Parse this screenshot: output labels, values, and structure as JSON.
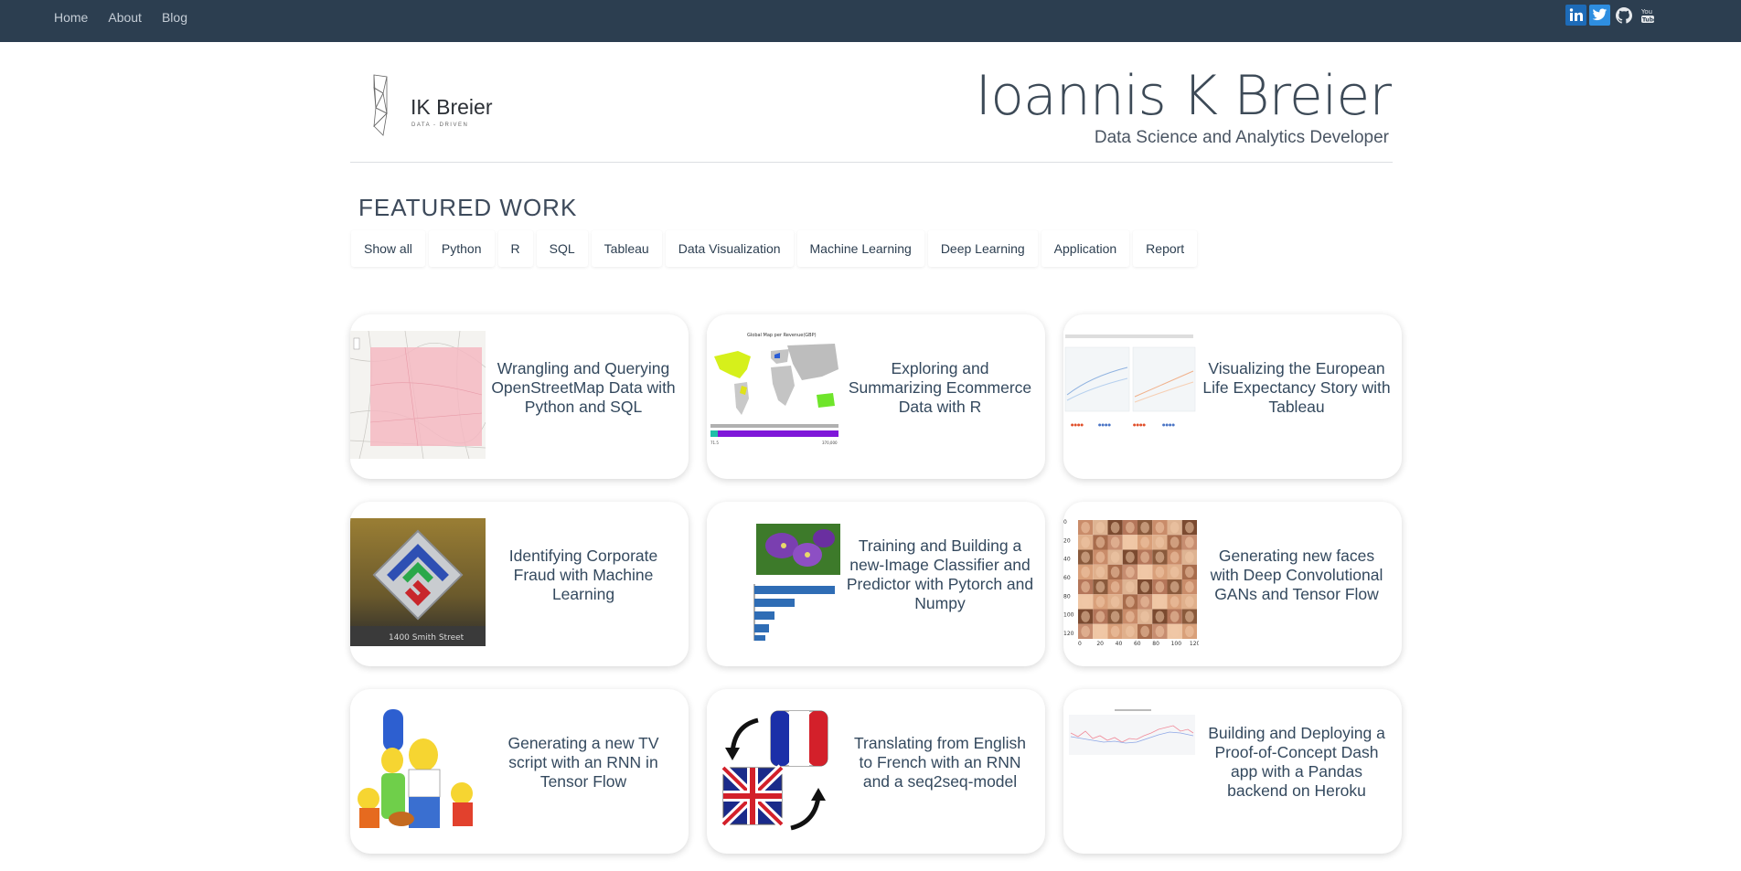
{
  "nav": {
    "links": [
      "Home",
      "About",
      "Blog"
    ],
    "social": [
      "linkedin-icon",
      "twitter-icon",
      "github-icon",
      "youtube-icon"
    ]
  },
  "header": {
    "logo_text": "IK Breier",
    "logo_sub": "DATA - DRIVEN",
    "title": "Ioannis K Breier",
    "subtitle": "Data Science and Analytics Developer"
  },
  "featured": {
    "heading": "FEATURED WORK",
    "filters": [
      "Show all",
      "Python",
      "R",
      "SQL",
      "Tableau",
      "Data Visualization",
      "Machine Learning",
      "Deep Learning",
      "Application",
      "Report"
    ]
  },
  "cards": [
    {
      "title": "Wrangling and Querying OpenStreetMap Data with Python and SQL",
      "thumb": "map-thumbnail"
    },
    {
      "title": "Exploring and Summarizing Ecommerce Data with R",
      "thumb": "world-map-thumbnail",
      "thumb_title": "Global Map per Revenue(GBP)"
    },
    {
      "title": "Visualizing the European Life Expectancy Story with Tableau",
      "thumb": "dashboard-thumbnail"
    },
    {
      "title": "Identifying Corporate Fraud with Machine Learning",
      "thumb": "enron-logo-thumbnail",
      "thumb_text": "1400 Smith Street"
    },
    {
      "title": "Training and Building a new-Image Classifier and Predictor with Pytorch and Numpy",
      "thumb": "flower-classifier-thumbnail"
    },
    {
      "title": "Generating new faces with Deep Convolutional GANs and Tensor Flow",
      "thumb": "faces-grid-thumbnail",
      "thumb_ticks_y": [
        "0",
        "20",
        "40",
        "60",
        "80",
        "100",
        "120"
      ],
      "thumb_ticks_x": [
        "0",
        "20",
        "40",
        "60",
        "80",
        "100",
        "120"
      ]
    },
    {
      "title": "Generating a new TV script with an RNN in Tensor Flow",
      "thumb": "cartoon-family-thumbnail"
    },
    {
      "title": "Translating from English to French with an RNN and a seq2seq-model",
      "thumb": "flags-thumbnail"
    },
    {
      "title": "Building and Deploying a Proof-of-Concept Dash app with a Pandas backend on Heroku",
      "thumb": "line-chart-thumbnail"
    }
  ],
  "colors": {
    "nav_bg": "#2c3e50",
    "text": "#34495e",
    "linkedin": "#1d6bb8",
    "twitter": "#2e8ee0"
  }
}
